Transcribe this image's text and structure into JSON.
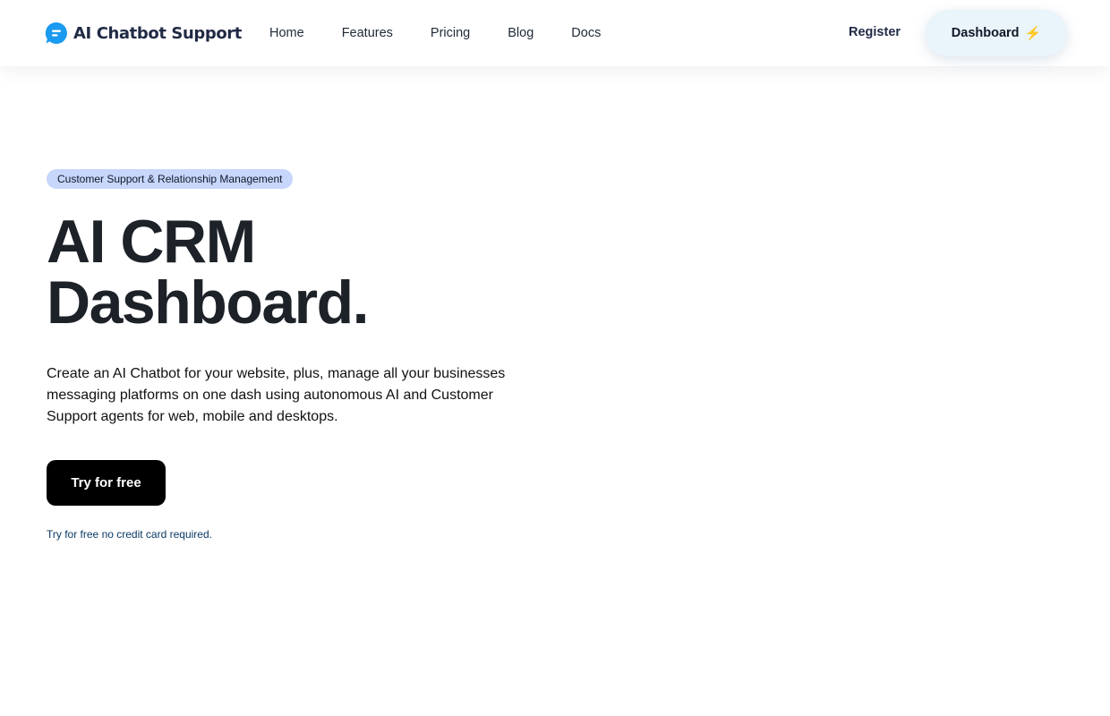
{
  "brand": {
    "name": "AI Chatbot Support",
    "icon": "chat-bubble-icon",
    "color": "#1a9af0"
  },
  "nav": {
    "items": [
      "Home",
      "Features",
      "Pricing",
      "Blog",
      "Docs"
    ]
  },
  "header_actions": {
    "register_label": "Register",
    "dashboard_label": "Dashboard",
    "dashboard_icon": "⚡"
  },
  "hero": {
    "badge": "Customer Support & Relationship Management",
    "headline_line1": "AI CRM",
    "headline_line2": "Dashboard.",
    "lead": "Create an AI Chatbot for your website, plus, manage all your businesses messaging platforms on one dash using autonomous AI and Customer Support agents for web, mobile and desktops.",
    "cta_label": "Try for free",
    "note": "Try for free no credit card required."
  },
  "colors": {
    "badge_bg": "#c7d6fb",
    "cta_bg": "#000000",
    "dashboard_bg": "#eaf4fb"
  }
}
